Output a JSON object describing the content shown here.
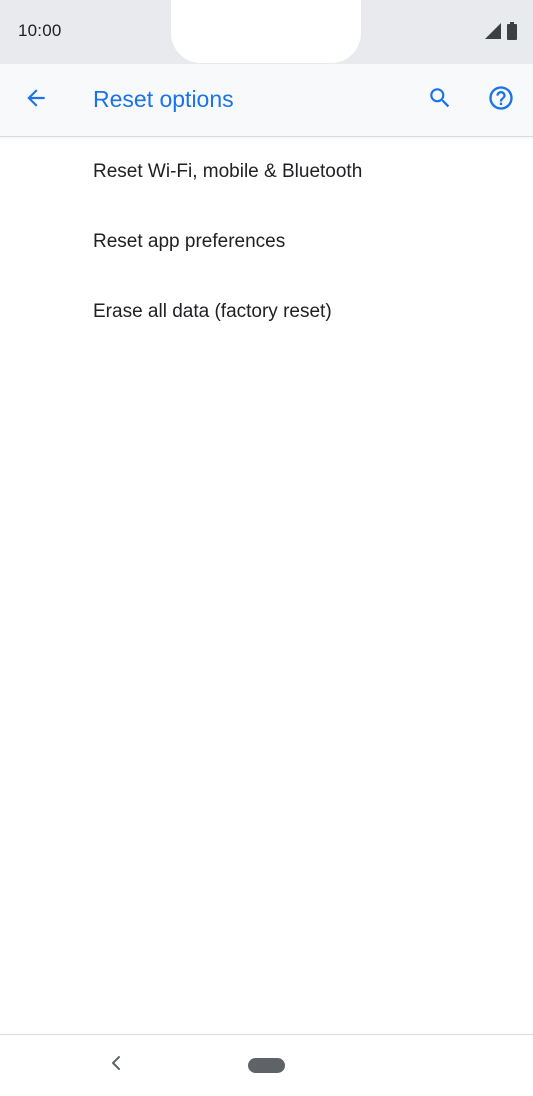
{
  "status_bar": {
    "time": "10:00"
  },
  "app_bar": {
    "title": "Reset options",
    "back_icon": "arrow-back-icon",
    "search_icon": "search-icon",
    "help_icon": "help-circle-icon"
  },
  "options": [
    {
      "label": "Reset Wi-Fi, mobile & Bluetooth"
    },
    {
      "label": "Reset app preferences"
    },
    {
      "label": "Erase all data (factory reset)"
    }
  ],
  "colors": {
    "accent": "#1a73e8",
    "status_bar_bg": "#e8eaed",
    "app_bar_bg": "#f8f9fa",
    "text_primary": "#202124",
    "nav_icon": "#5f6368"
  }
}
